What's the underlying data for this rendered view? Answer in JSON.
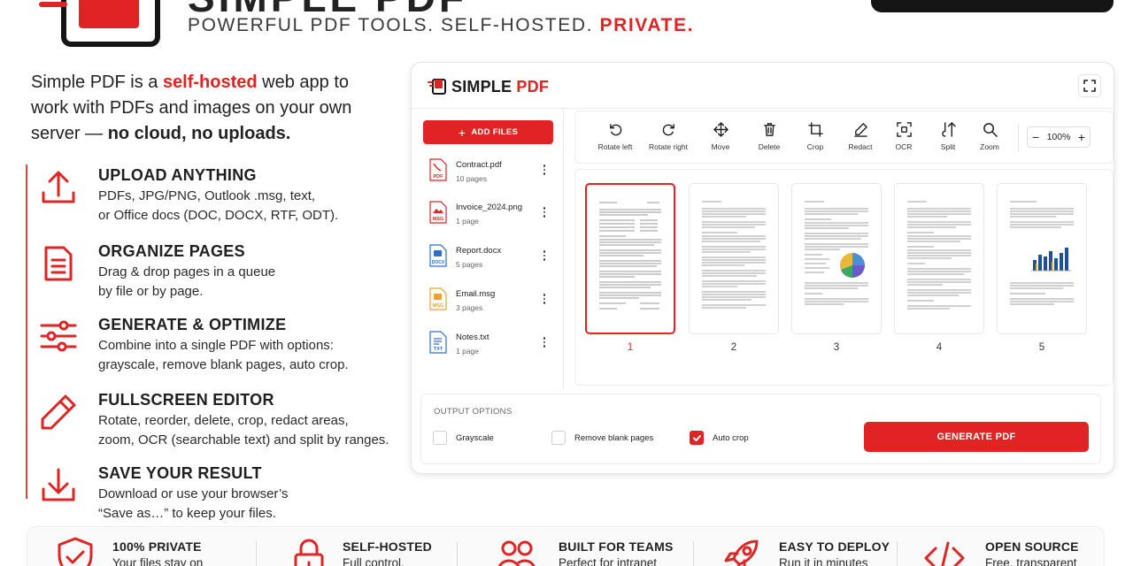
{
  "brand": {
    "title": "SIMPLE PDF",
    "tagline_main": "POWERFUL PDF TOOLS. SELF-HOSTED.",
    "tagline_accent": "PRIVATE.",
    "accent_color": "#e02424"
  },
  "intro": {
    "part1": "Simple PDF is a ",
    "highlight": "self-hosted",
    "part2": " web app to work with PDFs and images on your own server — ",
    "bold": "no cloud, no uploads."
  },
  "features": [
    {
      "icon": "upload-icon",
      "title": "UPLOAD ANYTHING",
      "line1": "PDFs, JPG/PNG, Outlook .msg, text,",
      "line2": "or Office docs (DOC, DOCX, RTF, ODT)."
    },
    {
      "icon": "document-icon",
      "title": "ORGANIZE PAGES",
      "line1": "Drag & drop pages in a queue",
      "line2": "by file or by page."
    },
    {
      "icon": "sliders-icon",
      "title": "GENERATE & OPTIMIZE",
      "line1": "Combine into a single PDF with options:",
      "line2": "grayscale, remove blank pages, auto crop."
    },
    {
      "icon": "pencil-icon",
      "title": "FULLSCREEN EDITOR",
      "line1": "Rotate, reorder, delete, crop, redact areas,",
      "line2": "zoom, OCR (searchable text) and split by ranges."
    },
    {
      "icon": "download-icon",
      "title": "SAVE YOUR RESULT",
      "line1": "Download or use your browser’s",
      "line2": "“Save as…” to keep your files."
    }
  ],
  "app": {
    "logo_main": "SIMPLE ",
    "logo_accent": "PDF",
    "add_files": "ADD FILES",
    "files": [
      {
        "name": "Contract.pdf",
        "meta": "10 pages",
        "badge": "PDF",
        "color": "#e02424"
      },
      {
        "name": "Invoice_2024.png",
        "meta": "1 page",
        "badge": "MSG",
        "color": "#e02424"
      },
      {
        "name": "Report.docx",
        "meta": "5 pages",
        "badge": "DOCX",
        "color": "#2b6fd6"
      },
      {
        "name": "Email.msg",
        "meta": "3 pages",
        "badge": "MSG",
        "color": "#f0a030"
      },
      {
        "name": "Notes.txt",
        "meta": "1 page",
        "badge": "TXT",
        "color": "#2b6fd6"
      }
    ],
    "tools": [
      {
        "icon": "rotate-left-icon",
        "label": "Rotate left"
      },
      {
        "icon": "rotate-right-icon",
        "label": "Rotate right"
      },
      {
        "icon": "move-icon",
        "label": "Move"
      },
      {
        "icon": "trash-icon",
        "label": "Delete"
      },
      {
        "icon": "crop-icon",
        "label": "Crop"
      },
      {
        "icon": "redact-icon",
        "label": "Redact"
      },
      {
        "icon": "ocr-icon",
        "label": "OCR"
      },
      {
        "icon": "split-icon",
        "label": "Split"
      },
      {
        "icon": "zoom-icon",
        "label": "Zoom"
      }
    ],
    "zoom": {
      "minus": "−",
      "value": "100%",
      "plus": "+"
    },
    "pages": [
      "1",
      "2",
      "3",
      "4",
      "5"
    ],
    "selected_page": "1",
    "output_title": "OUTPUT OPTIONS",
    "options": [
      {
        "label": "Grayscale",
        "checked": false
      },
      {
        "label": "Remove blank pages",
        "checked": false
      },
      {
        "label": "Auto crop",
        "checked": true
      }
    ],
    "generate": "GENERATE PDF"
  },
  "bottom": [
    {
      "icon": "shield-check-icon",
      "title": "100% PRIVATE",
      "desc": "Your files stay on"
    },
    {
      "icon": "lock-icon",
      "title": "SELF-HOSTED",
      "desc": "Full control."
    },
    {
      "icon": "team-icon",
      "title": "BUILT FOR TEAMS",
      "desc": "Perfect for intranet"
    },
    {
      "icon": "rocket-icon",
      "title": "EASY TO DEPLOY",
      "desc": "Run it in minutes"
    },
    {
      "icon": "code-icon",
      "title": "OPEN SOURCE",
      "desc": "Free, transparent"
    }
  ]
}
